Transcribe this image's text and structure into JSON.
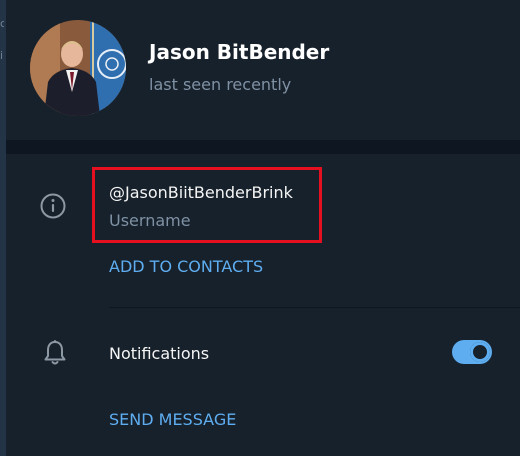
{
  "profile": {
    "name": "Jason BitBender",
    "status": "last seen recently"
  },
  "info": {
    "username_value": "@JasonBiitBenderBrink",
    "username_label": "Username",
    "add_contacts": "ADD TO CONTACTS"
  },
  "notifications": {
    "label": "Notifications",
    "enabled": true
  },
  "actions": {
    "send_message": "SEND MESSAGE"
  },
  "left_strip": [
    "c",
    "i"
  ],
  "icons": {
    "info": "info-icon",
    "notifications": "bell-icon",
    "avatar": "avatar-photo"
  },
  "colors": {
    "background": "#17212b",
    "separator": "#0e1621",
    "accent": "#5eadf0",
    "secondary_text": "#7f91a4",
    "highlight_box": "#e4101f"
  }
}
